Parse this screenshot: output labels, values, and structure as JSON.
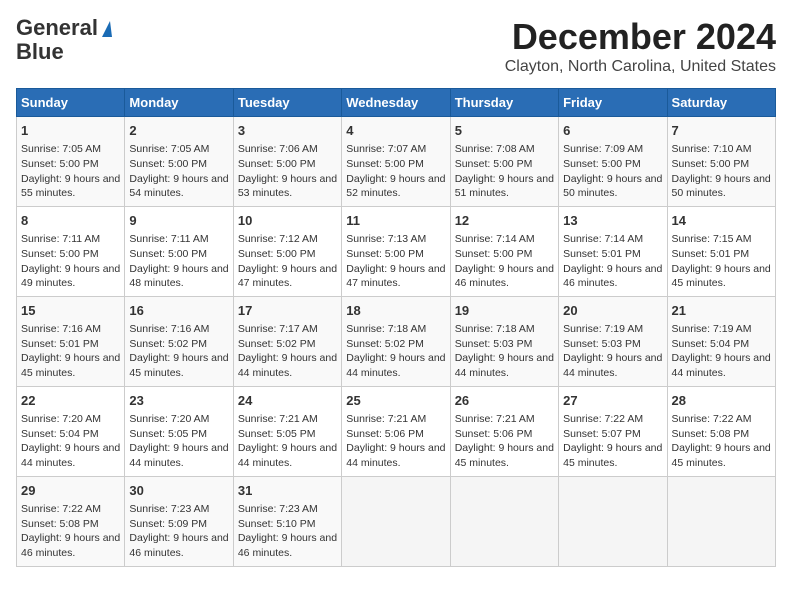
{
  "logo": {
    "line1": "General",
    "line2": "Blue"
  },
  "title": "December 2024",
  "subtitle": "Clayton, North Carolina, United States",
  "days_header": [
    "Sunday",
    "Monday",
    "Tuesday",
    "Wednesday",
    "Thursday",
    "Friday",
    "Saturday"
  ],
  "weeks": [
    [
      {
        "day": "1",
        "info": "Sunrise: 7:05 AM\nSunset: 5:00 PM\nDaylight: 9 hours and 55 minutes."
      },
      {
        "day": "2",
        "info": "Sunrise: 7:05 AM\nSunset: 5:00 PM\nDaylight: 9 hours and 54 minutes."
      },
      {
        "day": "3",
        "info": "Sunrise: 7:06 AM\nSunset: 5:00 PM\nDaylight: 9 hours and 53 minutes."
      },
      {
        "day": "4",
        "info": "Sunrise: 7:07 AM\nSunset: 5:00 PM\nDaylight: 9 hours and 52 minutes."
      },
      {
        "day": "5",
        "info": "Sunrise: 7:08 AM\nSunset: 5:00 PM\nDaylight: 9 hours and 51 minutes."
      },
      {
        "day": "6",
        "info": "Sunrise: 7:09 AM\nSunset: 5:00 PM\nDaylight: 9 hours and 50 minutes."
      },
      {
        "day": "7",
        "info": "Sunrise: 7:10 AM\nSunset: 5:00 PM\nDaylight: 9 hours and 50 minutes."
      }
    ],
    [
      {
        "day": "8",
        "info": "Sunrise: 7:11 AM\nSunset: 5:00 PM\nDaylight: 9 hours and 49 minutes."
      },
      {
        "day": "9",
        "info": "Sunrise: 7:11 AM\nSunset: 5:00 PM\nDaylight: 9 hours and 48 minutes."
      },
      {
        "day": "10",
        "info": "Sunrise: 7:12 AM\nSunset: 5:00 PM\nDaylight: 9 hours and 47 minutes."
      },
      {
        "day": "11",
        "info": "Sunrise: 7:13 AM\nSunset: 5:00 PM\nDaylight: 9 hours and 47 minutes."
      },
      {
        "day": "12",
        "info": "Sunrise: 7:14 AM\nSunset: 5:00 PM\nDaylight: 9 hours and 46 minutes."
      },
      {
        "day": "13",
        "info": "Sunrise: 7:14 AM\nSunset: 5:01 PM\nDaylight: 9 hours and 46 minutes."
      },
      {
        "day": "14",
        "info": "Sunrise: 7:15 AM\nSunset: 5:01 PM\nDaylight: 9 hours and 45 minutes."
      }
    ],
    [
      {
        "day": "15",
        "info": "Sunrise: 7:16 AM\nSunset: 5:01 PM\nDaylight: 9 hours and 45 minutes."
      },
      {
        "day": "16",
        "info": "Sunrise: 7:16 AM\nSunset: 5:02 PM\nDaylight: 9 hours and 45 minutes."
      },
      {
        "day": "17",
        "info": "Sunrise: 7:17 AM\nSunset: 5:02 PM\nDaylight: 9 hours and 44 minutes."
      },
      {
        "day": "18",
        "info": "Sunrise: 7:18 AM\nSunset: 5:02 PM\nDaylight: 9 hours and 44 minutes."
      },
      {
        "day": "19",
        "info": "Sunrise: 7:18 AM\nSunset: 5:03 PM\nDaylight: 9 hours and 44 minutes."
      },
      {
        "day": "20",
        "info": "Sunrise: 7:19 AM\nSunset: 5:03 PM\nDaylight: 9 hours and 44 minutes."
      },
      {
        "day": "21",
        "info": "Sunrise: 7:19 AM\nSunset: 5:04 PM\nDaylight: 9 hours and 44 minutes."
      }
    ],
    [
      {
        "day": "22",
        "info": "Sunrise: 7:20 AM\nSunset: 5:04 PM\nDaylight: 9 hours and 44 minutes."
      },
      {
        "day": "23",
        "info": "Sunrise: 7:20 AM\nSunset: 5:05 PM\nDaylight: 9 hours and 44 minutes."
      },
      {
        "day": "24",
        "info": "Sunrise: 7:21 AM\nSunset: 5:05 PM\nDaylight: 9 hours and 44 minutes."
      },
      {
        "day": "25",
        "info": "Sunrise: 7:21 AM\nSunset: 5:06 PM\nDaylight: 9 hours and 44 minutes."
      },
      {
        "day": "26",
        "info": "Sunrise: 7:21 AM\nSunset: 5:06 PM\nDaylight: 9 hours and 45 minutes."
      },
      {
        "day": "27",
        "info": "Sunrise: 7:22 AM\nSunset: 5:07 PM\nDaylight: 9 hours and 45 minutes."
      },
      {
        "day": "28",
        "info": "Sunrise: 7:22 AM\nSunset: 5:08 PM\nDaylight: 9 hours and 45 minutes."
      }
    ],
    [
      {
        "day": "29",
        "info": "Sunrise: 7:22 AM\nSunset: 5:08 PM\nDaylight: 9 hours and 46 minutes."
      },
      {
        "day": "30",
        "info": "Sunrise: 7:23 AM\nSunset: 5:09 PM\nDaylight: 9 hours and 46 minutes."
      },
      {
        "day": "31",
        "info": "Sunrise: 7:23 AM\nSunset: 5:10 PM\nDaylight: 9 hours and 46 minutes."
      },
      null,
      null,
      null,
      null
    ]
  ]
}
